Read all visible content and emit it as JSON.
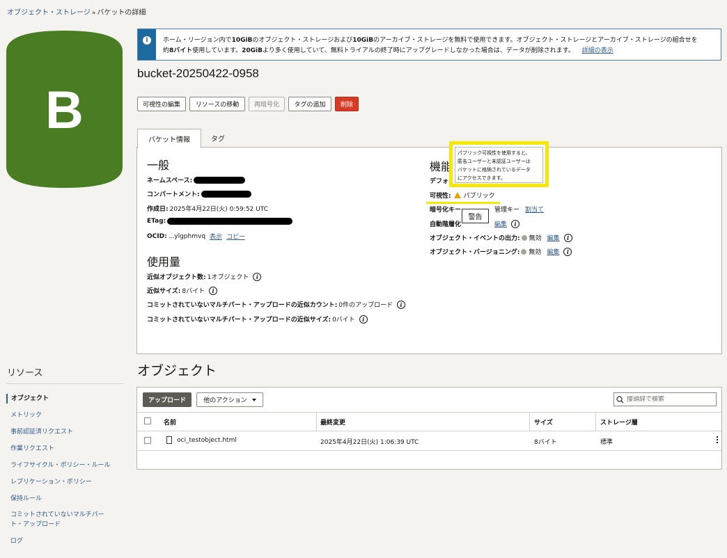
{
  "breadcrumb": {
    "parent": "オブジェクト・ストレージ",
    "separator": "»",
    "current": "バケットの詳細"
  },
  "logo": {
    "letter": "B",
    "color": "#4a7c23"
  },
  "banner": {
    "line1_a": "ホーム・リージョン内で",
    "line1_b": "10GiB",
    "line1_c": "のオブジェクト・ストレージおよび",
    "line1_d": "10GiB",
    "line1_e": "のアーカイブ・ストレージを無料で使用できます。オブジェクト・ストレージとアーカイブ・ストレージの組合せを",
    "line2_a": "約",
    "line2_b": "8バイト",
    "line2_c": "使用しています。",
    "line2_d": "20GiB",
    "line2_e": "より多く使用していて、無料トライアルの終了時にアップグレードしなかった場合は、データが削除されます。",
    "details_link": "詳細の表示"
  },
  "bucket_title": "bucket-20250422-0958",
  "actions": {
    "edit_visibility": "可視性の編集",
    "move_resource": "リソースの移動",
    "re_encrypt": "再暗号化",
    "add_tags": "タグの追加",
    "delete": "削除"
  },
  "tabs": {
    "bucket_info": "バケット情報",
    "tags": "タグ"
  },
  "general": {
    "heading": "一般",
    "namespace_label": "ネームスペース:",
    "compartment_label": "コンパートメント:",
    "created_label": "作成日:",
    "created_value": "2025年4月22日(火) 0:59:52 UTC",
    "etag_label": "ETag:",
    "ocid_label": "OCID:",
    "ocid_value": "...ylgphmvq",
    "ocid_show": "表示",
    "ocid_copy": "コピー"
  },
  "usage": {
    "heading": "使用量",
    "approx_objects_label": "近似オブジェクト数:",
    "approx_objects_value": "1オブジェクト",
    "approx_size_label": "近似サイズ:",
    "approx_size_value": "8バイト",
    "uncommitted_count_label": "コミットされていないマルチパート・アップロードの近似カウント:",
    "uncommitted_count_value": "0件のアップロード",
    "uncommitted_size_label": "コミットされていないマルチパート・アップロードの近似サイズ:",
    "uncommitted_size_value": "0バイト"
  },
  "features": {
    "heading": "機能",
    "default_label": "デフォ",
    "visibility_label": "可視性:",
    "visibility_value": "パブリック",
    "encryption_label": "暗号化キー",
    "encryption_value": "管理キー",
    "encryption_assign": "割当て",
    "auto_tiering_label": "自動階層化",
    "auto_tiering_edit": "編集",
    "events_label": "オブジェクト・イベントの出力:",
    "events_value": "無効",
    "events_edit": "編集",
    "versioning_label": "オブジェクト・バージョニング:",
    "versioning_value": "無効",
    "versioning_edit": "編集"
  },
  "tooltip": {
    "line1": "パブリック可視性を使用すると、",
    "line2": "匿名ユーザーと未認証ユーザーは",
    "line3": "バケットに格納されているデータ",
    "line4": "にアクセスできます。",
    "warning": "警告"
  },
  "sidebar": {
    "title": "リソース",
    "items": [
      {
        "label": "オブジェクト",
        "active": true
      },
      {
        "label": "メトリック"
      },
      {
        "label": "事前認証済リクエスト"
      },
      {
        "label": "作業リクエスト"
      },
      {
        "label": "ライフサイクル・ポリシー・ルール"
      },
      {
        "label": "レプリケーション・ポリシー"
      },
      {
        "label": "保持ルール"
      },
      {
        "label": "コミットされていないマルチパー"
      },
      {
        "label": "ト・アップロード"
      },
      {
        "label": "ログ"
      }
    ]
  },
  "objects": {
    "heading": "オブジェクト",
    "upload": "アップロード",
    "more_actions": "他のアクション",
    "search_placeholder": "接頭辞で検索",
    "columns": {
      "name": "名前",
      "modified": "最終変更",
      "size": "サイズ",
      "tier": "ストレージ層"
    },
    "rows": [
      {
        "name": "oci_testobject.html",
        "modified": "2025年4月22日(火) 1:06:39 UTC",
        "size": "8バイト",
        "tier": "標準"
      }
    ]
  }
}
